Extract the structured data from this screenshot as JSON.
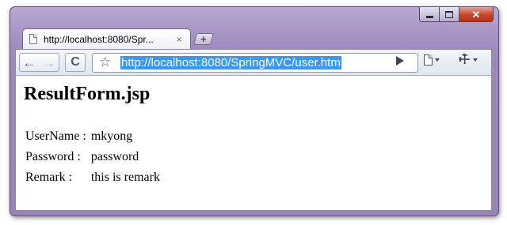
{
  "window": {
    "controls": {
      "minimize_icon": "minimize-icon",
      "maximize_icon": "maximize-icon",
      "close_glyph": "✕"
    }
  },
  "tab": {
    "title": "http://localhost:8080/Spr...",
    "close_glyph": "×",
    "new_tab_glyph": "+"
  },
  "toolbar": {
    "back_glyph": "←",
    "forward_glyph": "→",
    "reload_glyph": "C",
    "star_glyph": "☆",
    "url": "http://localhost:8080/SpringMVC/user.htm",
    "wrench_glyph": "🔧"
  },
  "page": {
    "title": "ResultForm.jsp",
    "rows": [
      {
        "label": "UserName :",
        "value": "mkyong"
      },
      {
        "label": "Password :",
        "value": "password"
      },
      {
        "label": "Remark :",
        "value": "this is remark"
      }
    ]
  },
  "colors": {
    "frame": "#a995c6",
    "url_highlight": "#3399ff",
    "close_button": "#c8452b"
  }
}
